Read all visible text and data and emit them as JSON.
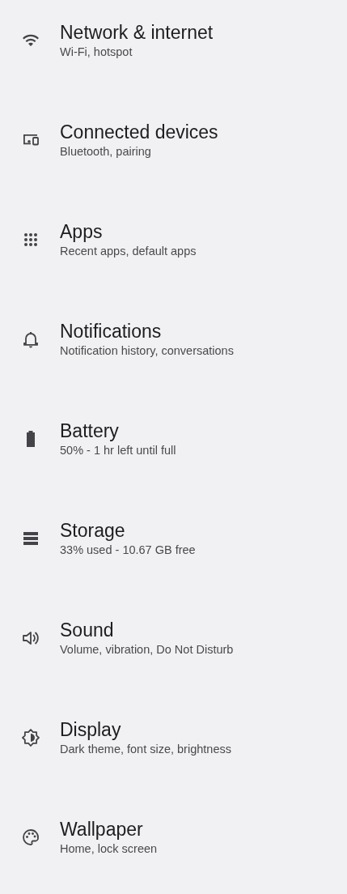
{
  "settings": [
    {
      "title": "Network & internet",
      "subtitle": "Wi-Fi, hotspot"
    },
    {
      "title": "Connected devices",
      "subtitle": "Bluetooth, pairing"
    },
    {
      "title": "Apps",
      "subtitle": "Recent apps, default apps"
    },
    {
      "title": "Notifications",
      "subtitle": "Notification history, conversations"
    },
    {
      "title": "Battery",
      "subtitle": "50% - 1 hr left until full"
    },
    {
      "title": "Storage",
      "subtitle": "33% used - 10.67 GB free"
    },
    {
      "title": "Sound",
      "subtitle": "Volume, vibration, Do Not Disturb"
    },
    {
      "title": "Display",
      "subtitle": "Dark theme, font size, brightness"
    },
    {
      "title": "Wallpaper",
      "subtitle": "Home, lock screen"
    }
  ]
}
